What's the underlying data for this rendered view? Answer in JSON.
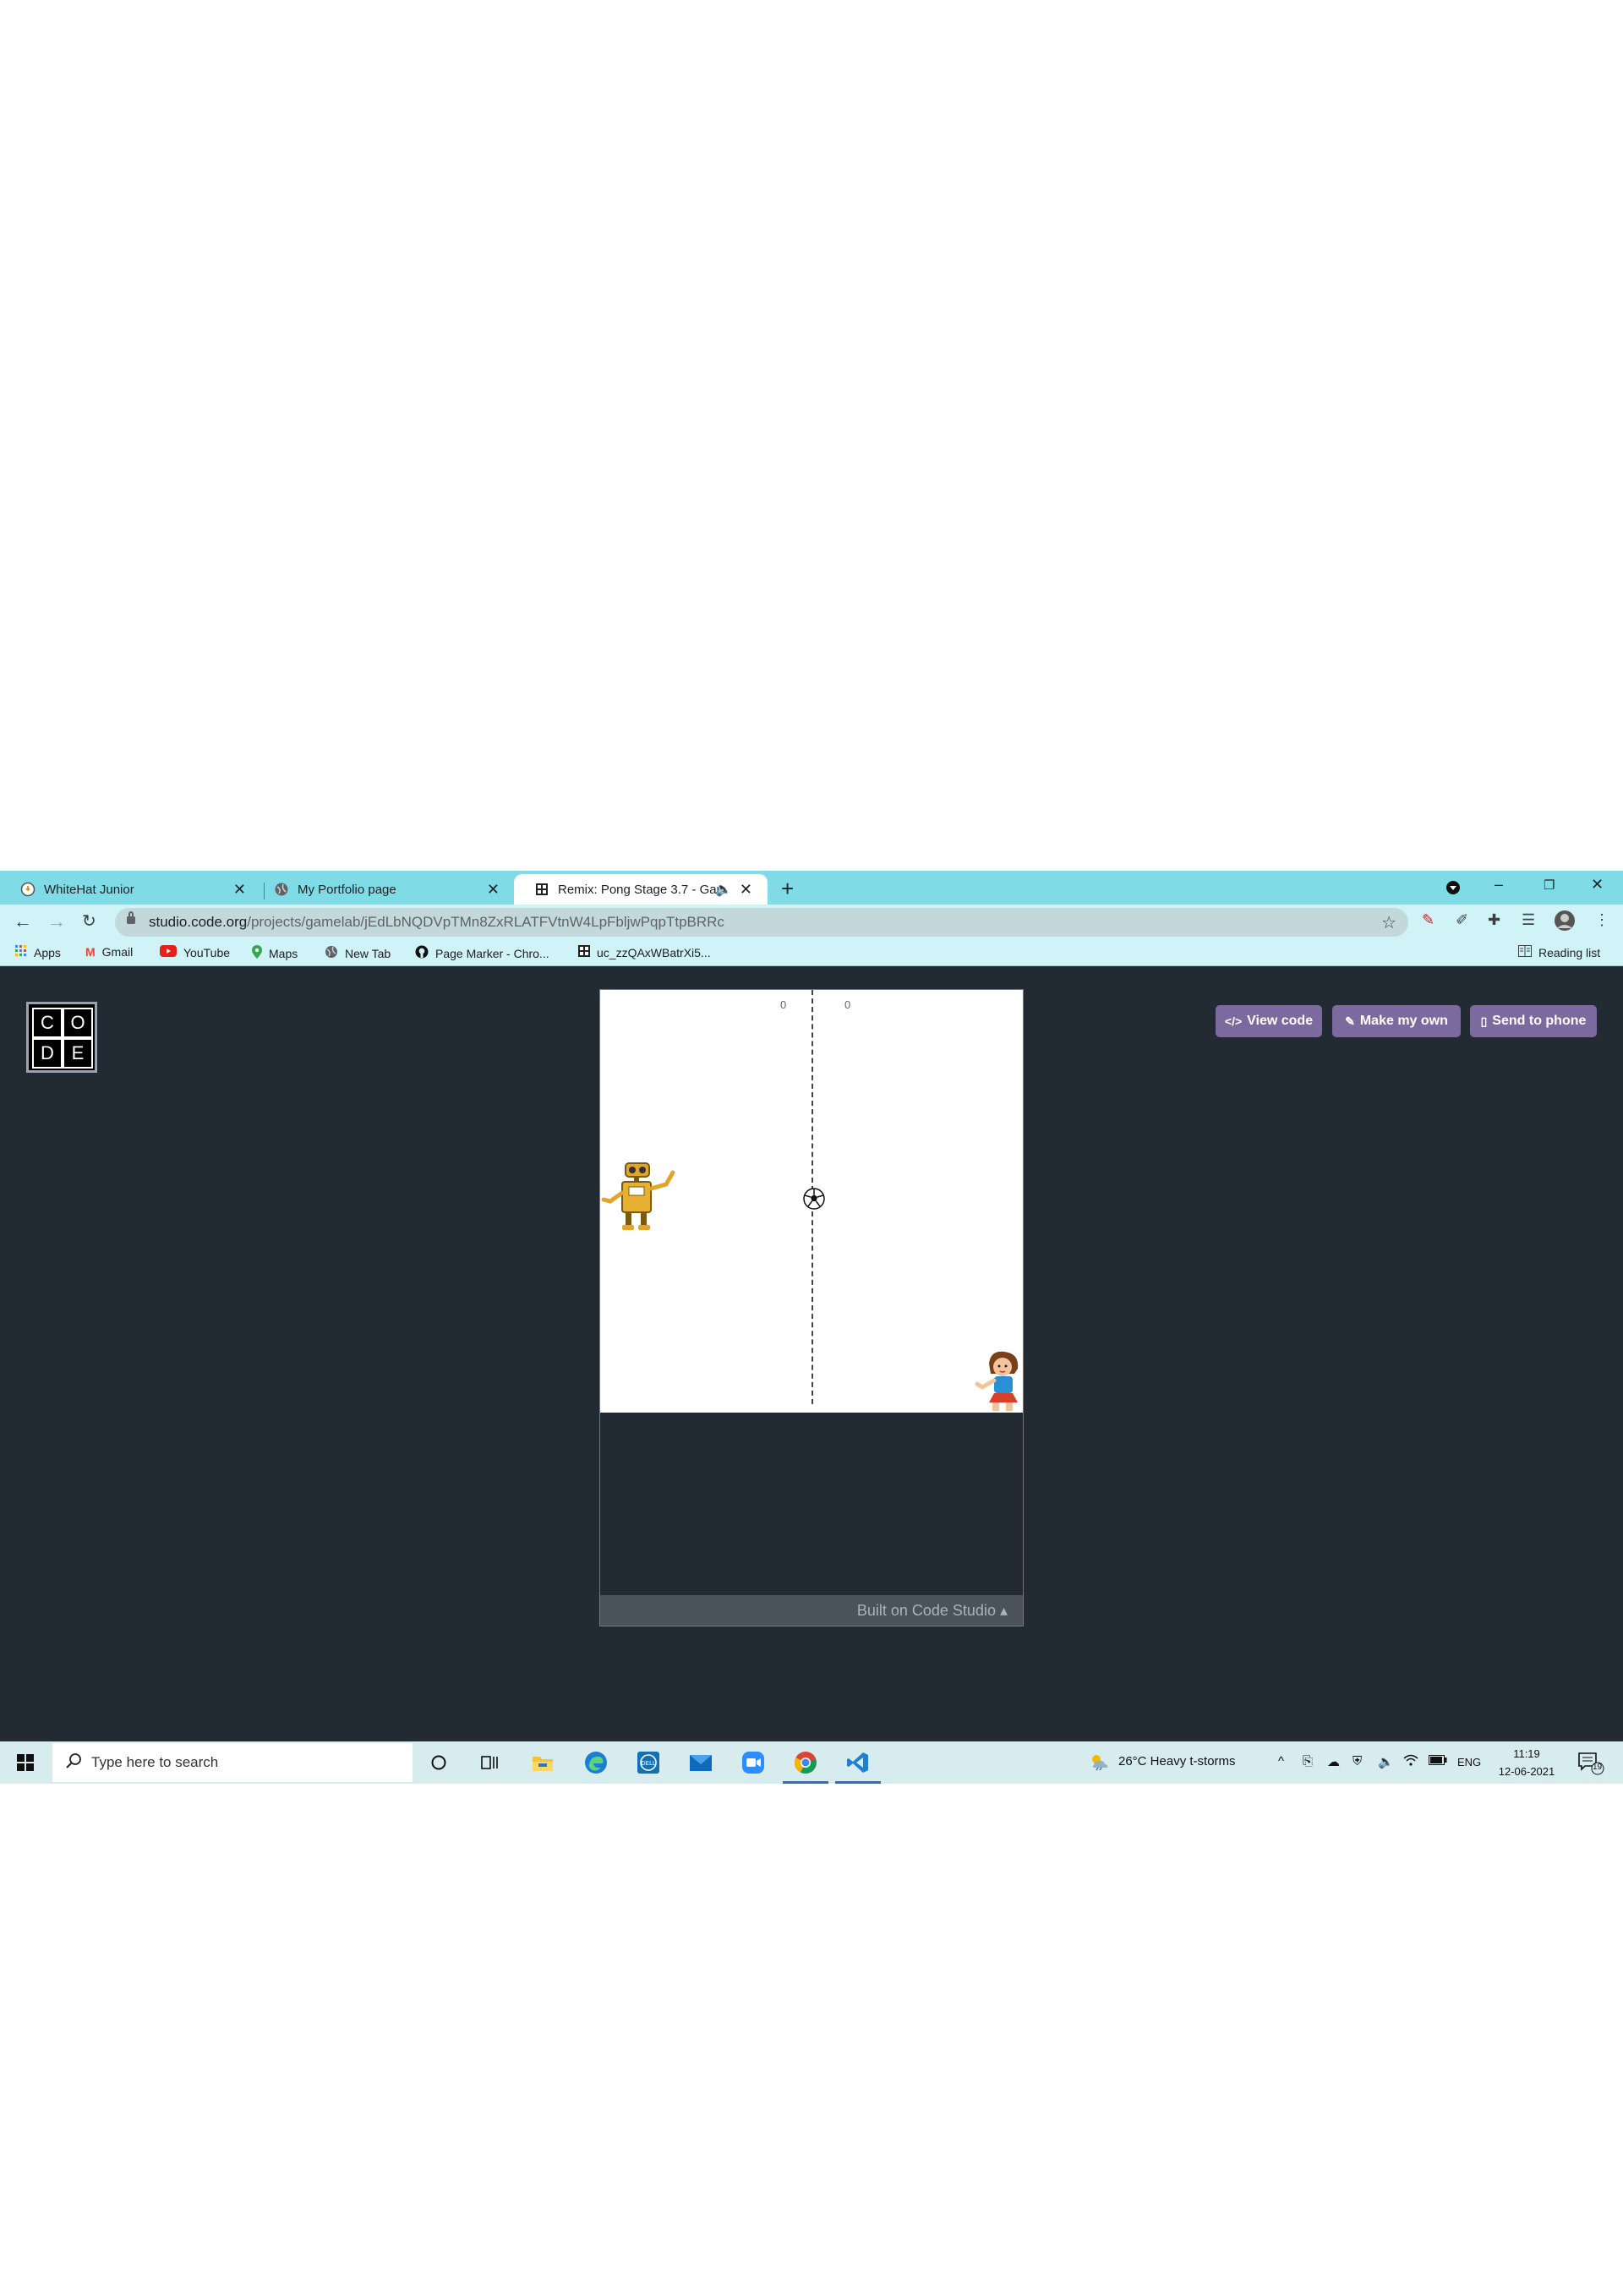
{
  "browser": {
    "tabs": [
      {
        "title": "WhiteHat Junior",
        "icon": "whitehat-icon"
      },
      {
        "title": "My Portfolio page",
        "icon": "globe-icon"
      },
      {
        "title": "Remix: Pong Stage 3.7 - Gam",
        "icon": "codeorg-grid-icon",
        "audio": true
      }
    ],
    "url_host": "studio.code.org",
    "url_path": "/projects/gamelab/jEdLbNQDVpTMn8ZxRLATFVtnW4LpFbljwPqpTtpBRRc",
    "bookmarks": [
      {
        "label": "Apps",
        "icon": "apps-grid-icon"
      },
      {
        "label": "Gmail",
        "icon": "gmail-icon"
      },
      {
        "label": "YouTube",
        "icon": "youtube-icon"
      },
      {
        "label": "Maps",
        "icon": "maps-pin-icon"
      },
      {
        "label": "New Tab",
        "icon": "globe-icon"
      },
      {
        "label": "Page Marker - Chro...",
        "icon": "github-icon"
      },
      {
        "label": "uc_zzQAxWBatrXi5...",
        "icon": "codeorg-grid-icon"
      }
    ],
    "reading_list": "Reading list"
  },
  "page": {
    "logo_letters": [
      "C",
      "O",
      "D",
      "E"
    ],
    "buttons": {
      "view_code": "View code",
      "make_my_own": "Make my own",
      "send_to_phone": "Send to phone"
    },
    "game": {
      "score_left": "0",
      "score_right": "0",
      "footer": "Built on Code Studio ▴"
    }
  },
  "taskbar": {
    "search_placeholder": "Type here to search",
    "weather": "26°C  Heavy t-storms",
    "language": "ENG",
    "time": "11:19",
    "date": "12-06-2021",
    "notifications": "19"
  },
  "colors": {
    "tab_strip": "#7fdbe6",
    "toolbar": "#cff3f7",
    "page_bg": "#222a33",
    "button_purple": "#7a6a9d",
    "taskbar": "#d7ecef"
  }
}
